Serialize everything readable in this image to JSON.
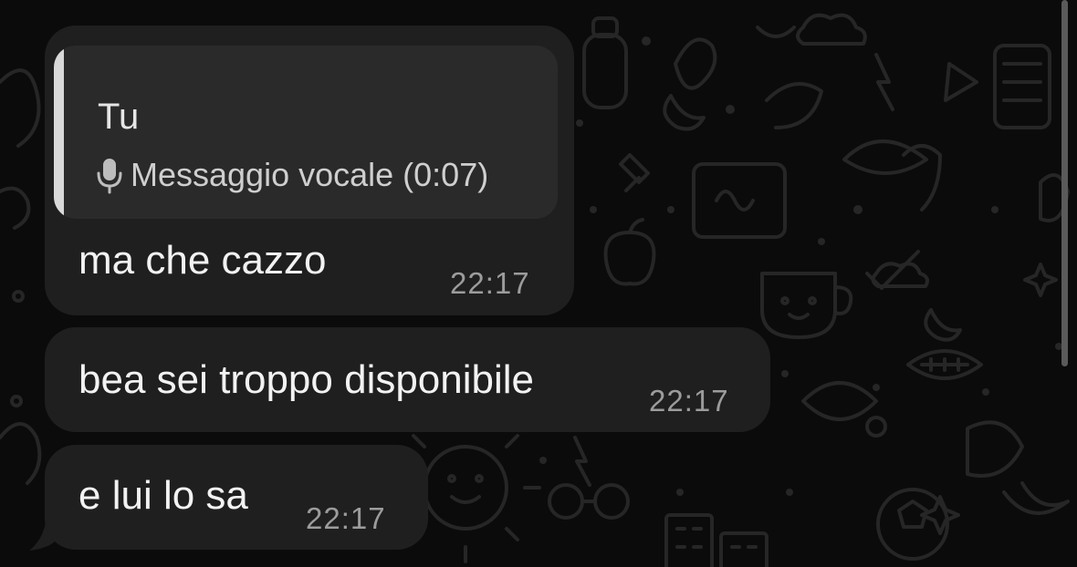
{
  "messages": [
    {
      "reply": {
        "author": "Tu",
        "icon": "mic-icon",
        "preview": "Messaggio vocale (0:07)"
      },
      "text": "ma che cazzo",
      "time": "22:17"
    },
    {
      "text": "bea sei troppo disponibile",
      "time": "22:17"
    },
    {
      "text": "e lui lo sa",
      "time": "22:17"
    }
  ],
  "colors": {
    "background": "#0b0b0b",
    "bubble": "#1f1f1f",
    "quote_background": "#2a2a2a",
    "quote_bar": "#d9d9d9",
    "time": "#9c9c9c"
  }
}
